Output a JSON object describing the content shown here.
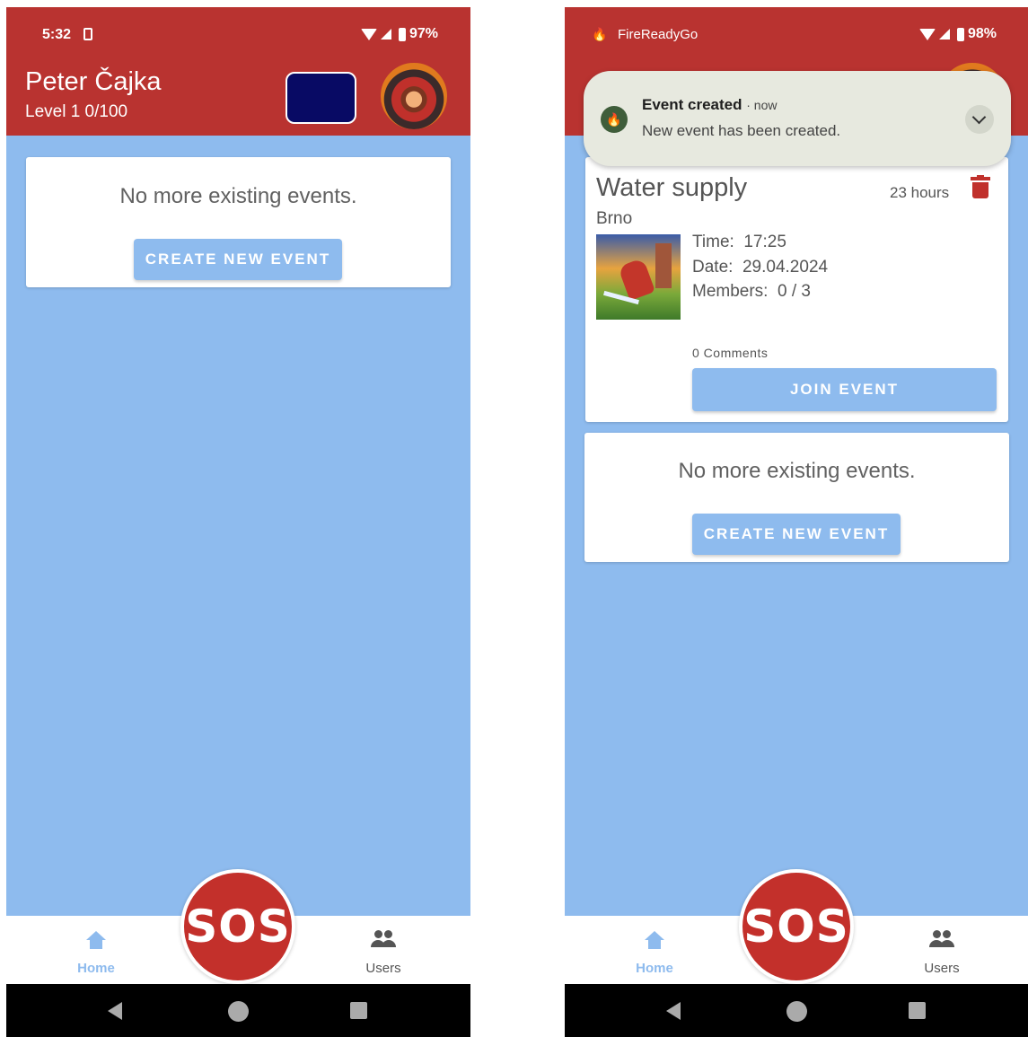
{
  "left_screen": {
    "status_bar": {
      "time": "5:32",
      "battery": "97%"
    },
    "header": {
      "user_name": "Peter Čajka",
      "level_text": "Level 1  0/100"
    },
    "empty_state": {
      "message": "No more existing events.",
      "create_button": "CREATE NEW EVENT"
    },
    "sos_label": "SOS",
    "bottom_nav": {
      "home": "Home",
      "users": "Users"
    }
  },
  "right_screen": {
    "status_bar": {
      "app_name": "FireReadyGo",
      "battery": "98%"
    },
    "notification": {
      "title": "Event created",
      "time": "now",
      "body": "New event has been created."
    },
    "event": {
      "title": "Water supply",
      "age": "23 hours",
      "city": "Brno",
      "time_label": "Time:",
      "time": "17:25",
      "date_label": "Date:",
      "date": "29.04.2024",
      "members_label": "Members:",
      "members": "0 / 3",
      "comments": "0 Comments",
      "join_button": "JOIN EVENT"
    },
    "empty_state": {
      "message": "No more existing events.",
      "create_button": "CREATE NEW EVENT"
    },
    "sos_label": "SOS",
    "bottom_nav": {
      "home": "Home",
      "users": "Users"
    }
  },
  "colors": {
    "primary_red": "#b93330",
    "background_blue": "#8ebbee",
    "dark_navy": "#080a64",
    "sos_red": "#c3302b"
  },
  "icons": [
    "home-icon",
    "users-icon",
    "trash-icon",
    "wifi-icon",
    "signal-icon",
    "battery-icon",
    "app-flame-icon",
    "chevron-down-icon",
    "back-icon",
    "home-circle-icon",
    "recents-icon"
  ]
}
